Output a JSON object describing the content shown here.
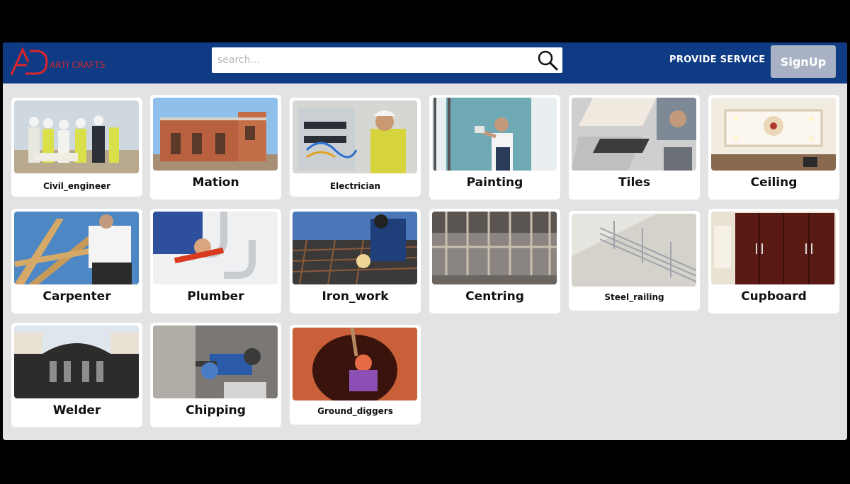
{
  "brand": {
    "name": "ARTI CRAFTS",
    "logo_letters": "AD",
    "accent": "#d8262c",
    "nav_bg": "#0e3b84"
  },
  "search": {
    "placeholder": "search...",
    "value": "",
    "icon": "search-icon"
  },
  "nav": {
    "provide_service": "PROVIDE SERVICE",
    "signup": "SignUp"
  },
  "services": [
    {
      "label": "Civil_engineer",
      "image": "engineers-on-site"
    },
    {
      "label": "Mation",
      "image": "brick-building"
    },
    {
      "label": "Electrician",
      "image": "electrician-panel"
    },
    {
      "label": "Painting",
      "image": "painter-wall"
    },
    {
      "label": "Tiles",
      "image": "tile-laying"
    },
    {
      "label": "Ceiling",
      "image": "false-ceiling"
    },
    {
      "label": "Carpenter",
      "image": "roof-framing"
    },
    {
      "label": "Plumber",
      "image": "sink-pipes"
    },
    {
      "label": "Iron_work",
      "image": "welding-rebar"
    },
    {
      "label": "Centring",
      "image": "scaffolding"
    },
    {
      "label": "Steel_railing",
      "image": "stair-railing"
    },
    {
      "label": "Cupboard",
      "image": "wardrobe"
    },
    {
      "label": "Welder",
      "image": "iron-gate"
    },
    {
      "label": "Chipping",
      "image": "hammer-drill"
    },
    {
      "label": "Ground_diggers",
      "image": "well-digging"
    }
  ]
}
